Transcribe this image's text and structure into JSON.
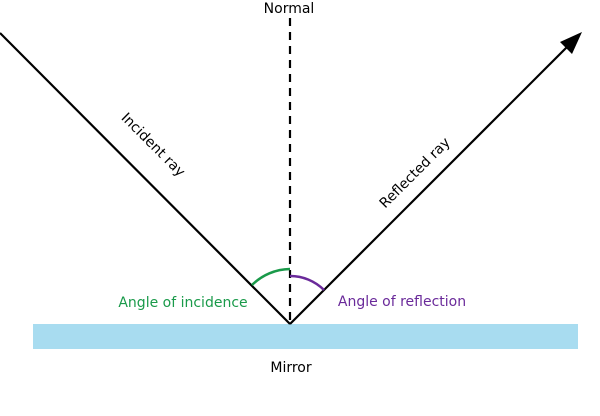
{
  "labels": {
    "normal": "Normal",
    "incident_ray": "Incident ray",
    "reflected_ray": "Reflected ray",
    "angle_of_incidence": "Angle of incidence",
    "angle_of_reflection": "Angle of reflection",
    "mirror": "Mirror"
  },
  "colors": {
    "ray": "#000000",
    "normal": "#000000",
    "mirror": "#a8dcf0",
    "incidence": "#1a9a4a",
    "reflection": "#6a2a9a",
    "text": "#000000"
  }
}
